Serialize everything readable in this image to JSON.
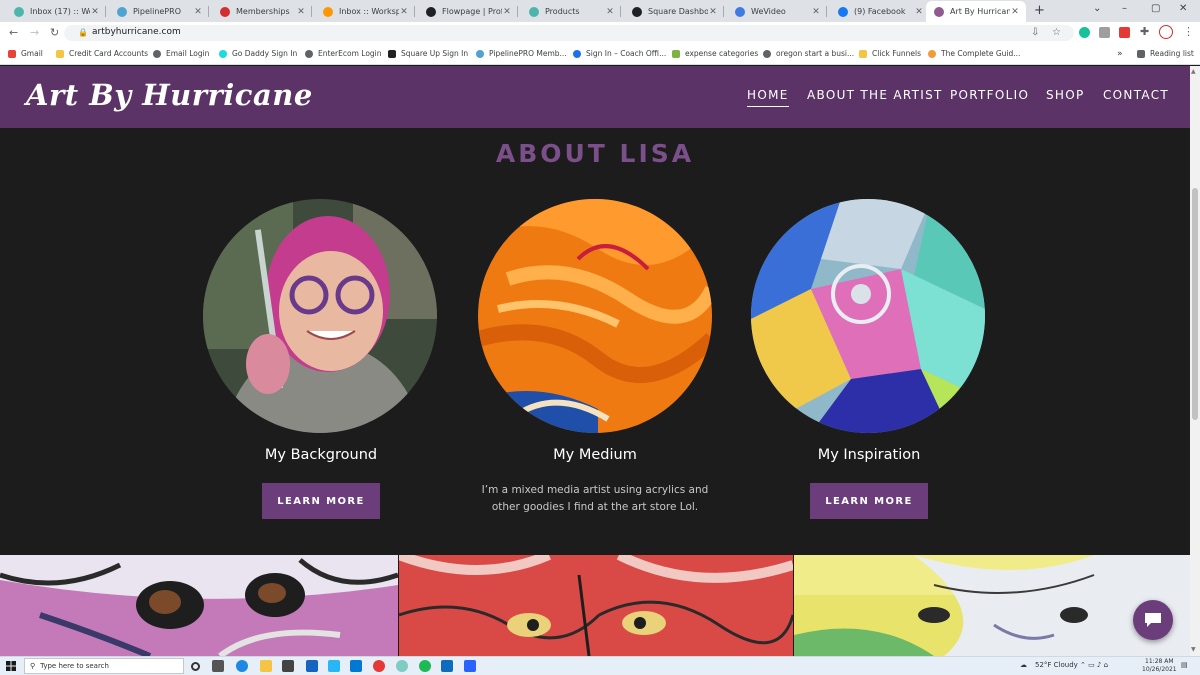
{
  "browser": {
    "tabs": [
      {
        "label": "Inbox (17) :: Work",
        "favicon_color": "#4db6ac"
      },
      {
        "label": "PipelinePRO",
        "favicon_color": "#4fa3d1"
      },
      {
        "label": "Memberships",
        "favicon_color": "#d32f2f"
      },
      {
        "label": "Inbox :: Workspace",
        "favicon_color": "#ff9800"
      },
      {
        "label": "Flowpage | Profile",
        "favicon_color": "#202124"
      },
      {
        "label": "Products",
        "favicon_color": "#4db6ac"
      },
      {
        "label": "Square Dashboard",
        "favicon_color": "#202124"
      },
      {
        "label": "WeVideo",
        "favicon_color": "#3f7be0"
      },
      {
        "label": "(9) Facebook",
        "favicon_color": "#1877f2"
      },
      {
        "label": "Art By Hurricane",
        "favicon_color": "#8e5a8f",
        "active": true
      }
    ],
    "new_tab": "+",
    "url": "artbyhurricane.com",
    "bookmarks": [
      {
        "label": "Gmail",
        "color": "#ea4335"
      },
      {
        "label": "Credit Card Accounts",
        "color": "#f4c542"
      },
      {
        "label": "Email Login",
        "color": "#5f6368"
      },
      {
        "label": "Go Daddy Sign In",
        "color": "#1bdbdb"
      },
      {
        "label": "EnterEcom Login",
        "color": "#5f6368"
      },
      {
        "label": "Square Up Sign In",
        "color": "#202124"
      },
      {
        "label": "PipelinePRO Memb...",
        "color": "#4fa3d1"
      },
      {
        "label": "Sign In – Coach Offi...",
        "color": "#1a73e8"
      },
      {
        "label": "expense categories",
        "color": "#7cb342"
      },
      {
        "label": "oregon start a busi...",
        "color": "#5f6368"
      },
      {
        "label": "Click Funnels",
        "color": "#f4c542"
      },
      {
        "label": "The Complete Guid...",
        "color": "#f29b38"
      }
    ],
    "bookmarks_more": "»",
    "reading_list": "Reading list"
  },
  "site": {
    "logo": "Art By Hurricane",
    "nav": [
      "HOME",
      "ABOUT THE ARTIST",
      "PORTFOLIO",
      "SHOP",
      "CONTACT"
    ],
    "section_title": "ABOUT LISA",
    "columns": [
      {
        "title": "My Background",
        "button": "LEARN MORE"
      },
      {
        "title": "My Medium",
        "text_line1": "I’m a mixed media artist using acrylics and",
        "text_line2": "other goodies I find at the art store Lol."
      },
      {
        "title": "My Inspiration",
        "button": "LEARN MORE"
      }
    ],
    "colors": {
      "header": "#5c3366",
      "accent": "#6b3d7b",
      "title": "#7b4f8a",
      "background": "#1c1c1c"
    }
  },
  "taskbar": {
    "search_placeholder": "Type here to search",
    "weather": "52°F Cloudy",
    "time": "11:28 AM",
    "date": "10/26/2021"
  }
}
